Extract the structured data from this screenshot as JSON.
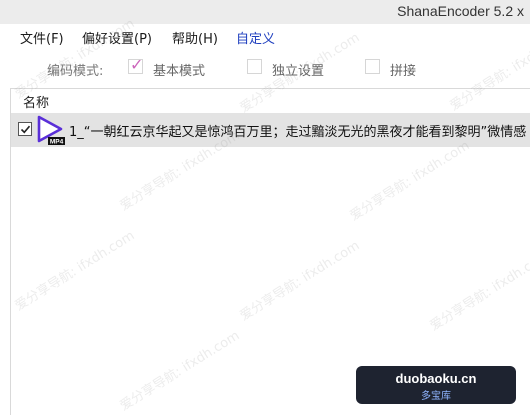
{
  "window": {
    "title": "ShanaEncoder 5.2 x"
  },
  "menu": {
    "file": "文件(F)",
    "prefs": "偏好设置(P)",
    "help": "帮助(H)",
    "custom": "自定义"
  },
  "encode_mode": {
    "label": "编码模式:",
    "options": [
      {
        "label": "基本模式",
        "checked": true
      },
      {
        "label": "独立设置",
        "checked": false
      },
      {
        "label": "拼接",
        "checked": false
      }
    ]
  },
  "file_list": {
    "column_name": "名称",
    "rows": [
      {
        "checked": true,
        "type_badge": "MP4",
        "name": "1_“一朝红云京华起又是惊鸿百万里；走过黯淡无光的黑夜才能看到黎明”微情感"
      }
    ]
  },
  "watermark": {
    "text": "爱分享导航: ifxdh.com"
  },
  "badge": {
    "line1": "duobaoku.cn",
    "line2": "多宝库"
  },
  "colors": {
    "menu_custom": "#1f3fbf",
    "check_accent": "#cc66bb",
    "row_selected": "#e3e3e3",
    "play_icon": "#5a2fd8"
  }
}
